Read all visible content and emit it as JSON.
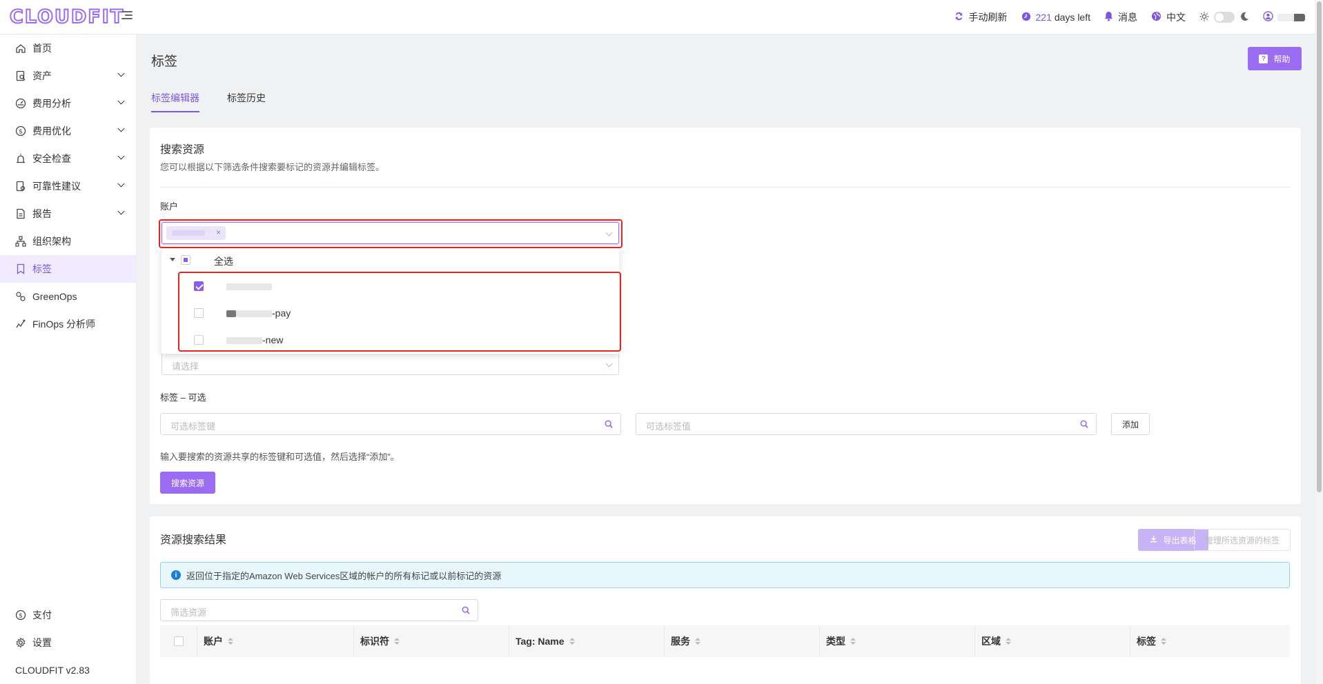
{
  "app": {
    "logo": "CLOUDFIT"
  },
  "topbar": {
    "refresh_label": "手动刷新",
    "days_count": "221",
    "days_suffix": "days left",
    "messages_label": "消息",
    "language_label": "中文"
  },
  "sidebar": {
    "items": [
      {
        "label": "首页",
        "icon": "home-icon",
        "expandable": false
      },
      {
        "label": "资产",
        "icon": "asset-icon",
        "expandable": true
      },
      {
        "label": "费用分析",
        "icon": "dashboard-icon",
        "expandable": true
      },
      {
        "label": "费用优化",
        "icon": "dollar-icon",
        "expandable": true
      },
      {
        "label": "安全检查",
        "icon": "alarm-icon",
        "expandable": true
      },
      {
        "label": "可靠性建议",
        "icon": "audit-icon",
        "expandable": true
      },
      {
        "label": "报告",
        "icon": "report-icon",
        "expandable": true
      },
      {
        "label": "组织架构",
        "icon": "org-icon",
        "expandable": false
      },
      {
        "label": "标签",
        "icon": "tag-icon",
        "expandable": false,
        "active": true
      },
      {
        "label": "GreenOps",
        "icon": "greenops-icon",
        "expandable": false
      },
      {
        "label": "FinOps 分析师",
        "icon": "analyst-icon",
        "expandable": false
      }
    ],
    "bottom": [
      {
        "label": "支付",
        "icon": "dollar-icon"
      },
      {
        "label": "设置",
        "icon": "gear-icon"
      }
    ],
    "version": "CLOUDFIT v2.83"
  },
  "page": {
    "title": "标签",
    "help_label": "帮助",
    "tabs": [
      {
        "label": "标签编辑器",
        "active": true
      },
      {
        "label": "标签历史",
        "active": false
      }
    ]
  },
  "search": {
    "title": "搜索资源",
    "description": "您可以根据以下筛选条件搜索要标记的资源并编辑标签。",
    "account_label": "账户",
    "dropdown": {
      "select_all": "全选",
      "options": [
        {
          "suffix": "",
          "checked": true
        },
        {
          "suffix": "-pay",
          "checked": false
        },
        {
          "suffix": "-new",
          "checked": false
        }
      ]
    },
    "region_placeholder": "请选择",
    "tags_label": "标签 – 可选",
    "tag_key_placeholder": "可选标签键",
    "tag_value_placeholder": "可选标签值",
    "add_label": "添加",
    "hint": "输入要搜索的资源共享的标签键和可选值，然后选择“添加”。",
    "search_button": "搜索资源"
  },
  "results": {
    "title": "资源搜索结果",
    "export_label": "导出表格",
    "manage_label": "管理所选资源的标签",
    "info": "返回位于指定的Amazon Web Services区域的帐户的所有标记或以前标记的资源",
    "filter_placeholder": "筛选资源",
    "columns": [
      "账户",
      "标识符",
      "Tag: Name",
      "服务",
      "类型",
      "区域",
      "标签"
    ]
  },
  "colors": {
    "accent": "#9b6bf2",
    "highlight": "#e0251d",
    "info": "#1a7fd6"
  }
}
